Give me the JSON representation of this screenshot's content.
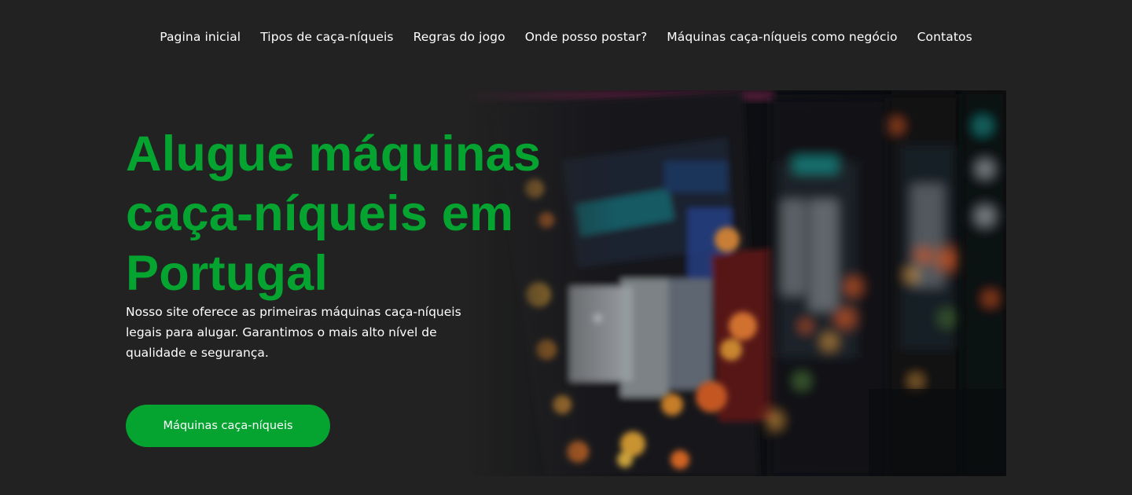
{
  "nav": {
    "items": [
      {
        "label": "Pagina inicial"
      },
      {
        "label": "Tipos de caça-níqueis"
      },
      {
        "label": "Regras do jogo"
      },
      {
        "label": "Onde posso postar?"
      },
      {
        "label": "Máquinas caça-níqueis como negócio"
      },
      {
        "label": "Contatos"
      }
    ]
  },
  "hero": {
    "title": "Alugue máquinas caça-níqueis em Portugal",
    "description": "Nosso site oferece as primeiras máquinas caça-níqueis legais para alugar. Garantimos o mais alto nível de qualidade e segurança.",
    "cta_label": "Máquinas caça-níqueis",
    "image_icon": "slot-machines-photo"
  },
  "colors": {
    "background": "#222222",
    "accent": "#05a330",
    "text": "#ffffff"
  }
}
